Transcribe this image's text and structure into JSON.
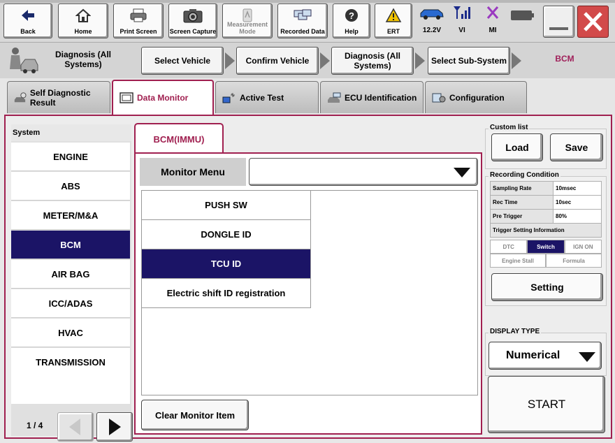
{
  "toolbar": {
    "buttons": [
      {
        "label": "Back",
        "icon": "back-arrow-icon"
      },
      {
        "label": "Home",
        "icon": "home-icon"
      },
      {
        "label": "Print Screen",
        "icon": "printer-icon"
      },
      {
        "label": "Screen Capture",
        "icon": "camera-icon"
      },
      {
        "label": "Measurement Mode",
        "icon": "measurement-icon",
        "disabled": true
      },
      {
        "label": "Recorded Data",
        "icon": "recorded-data-icon"
      },
      {
        "label": "Help",
        "icon": "help-icon"
      },
      {
        "label": "ERT",
        "icon": "warning-icon"
      }
    ],
    "status": [
      {
        "label": "12.2V",
        "icon": "car-battery-voltage-icon"
      },
      {
        "label": "VI",
        "icon": "signal-icon"
      },
      {
        "label": "MI",
        "icon": "x-mark-icon"
      }
    ],
    "battery_icon": "battery-icon"
  },
  "breadcrumb": {
    "home_label": "Diagnosis (All Systems)",
    "steps": [
      "Select Vehicle",
      "Confirm Vehicle",
      "Diagnosis (All Systems)",
      "Select Sub-System"
    ],
    "current": "BCM"
  },
  "function_tabs": [
    {
      "label": "Self Diagnostic Result",
      "active": false
    },
    {
      "label": "Data Monitor",
      "active": true
    },
    {
      "label": "Active Test",
      "active": false
    },
    {
      "label": "ECU Identification",
      "active": false
    },
    {
      "label": "Configuration",
      "active": false
    }
  ],
  "system_panel": {
    "header": "System",
    "items": [
      "ENGINE",
      "ABS",
      "METER/M&A",
      "BCM",
      "AIR BAG",
      "ICC/ADAS",
      "HVAC",
      "TRANSMISSION"
    ],
    "selected": "BCM",
    "page_indicator": "1 / 4"
  },
  "monitor": {
    "tab_label": "BCM(IMMU)",
    "menu_label": "Monitor Menu",
    "menu_value": "",
    "items": [
      "PUSH SW",
      "DONGLE ID",
      "TCU ID",
      "Electric shift ID registration"
    ],
    "selected": "TCU ID",
    "clear_label": "Clear Monitor Item"
  },
  "custom_list": {
    "title": "Custom list",
    "load_label": "Load",
    "save_label": "Save"
  },
  "recording": {
    "title": "Recording Condition",
    "rows": [
      {
        "label": "Sampling Rate",
        "value": "10msec"
      },
      {
        "label": "Rec Time",
        "value": "10sec"
      },
      {
        "label": "Pre Trigger",
        "value": "80%"
      }
    ],
    "trigger_title": "Trigger Setting Information",
    "trigger_row1": [
      "DTC",
      "Switch",
      "IGN ON"
    ],
    "trigger_row2": [
      "Engine Stall",
      "Formula"
    ],
    "trigger_active": "Switch",
    "setting_label": "Setting"
  },
  "display_type": {
    "title": "DISPLAY TYPE",
    "value": "Numerical",
    "start_label": "START"
  },
  "colors": {
    "accent": "#a02050",
    "selected_bg": "#1b1466"
  }
}
